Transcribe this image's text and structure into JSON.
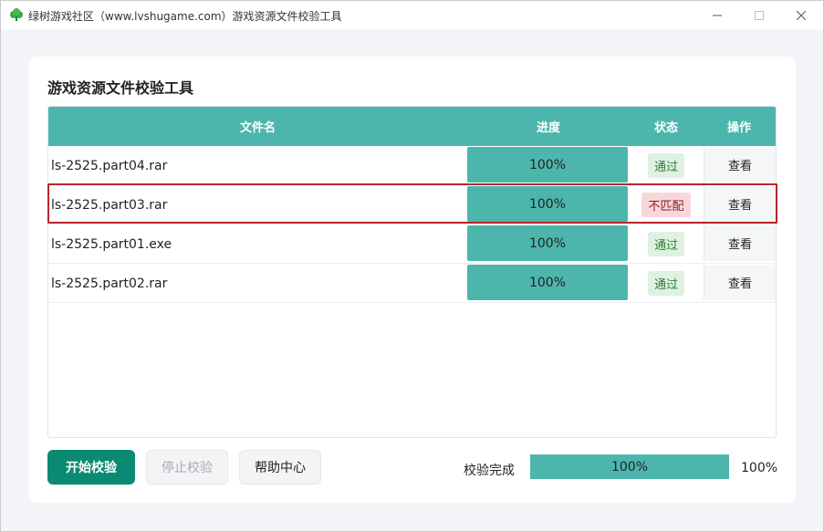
{
  "window": {
    "title": "绿树游戏社区（www.lvshugame.com）游戏资源文件校验工具",
    "controls": [
      "minimize-icon",
      "maximize-icon",
      "close-icon"
    ]
  },
  "card": {
    "title": "游戏资源文件校验工具"
  },
  "table": {
    "headers": {
      "name": "文件名",
      "progress": "进度",
      "status": "状态",
      "action": "操作"
    },
    "rows": [
      {
        "name": "ls-2525.part04.rar",
        "progress": "100%",
        "status": "通过",
        "status_type": "ok",
        "action": "查看"
      },
      {
        "name": "ls-2525.part03.rar",
        "progress": "100%",
        "status": "不匹配",
        "status_type": "bad",
        "action": "查看"
      },
      {
        "name": "ls-2525.part01.exe",
        "progress": "100%",
        "status": "通过",
        "status_type": "ok",
        "action": "查看"
      },
      {
        "name": "ls-2525.part02.rar",
        "progress": "100%",
        "status": "通过",
        "status_type": "ok",
        "action": "查看"
      }
    ]
  },
  "footer": {
    "start_button": "开始校验",
    "stop_button": "停止校验",
    "help_button": "帮助中心",
    "status_label": "校验完成",
    "overall_progress": "100%",
    "overall_percent": "100%"
  },
  "colors": {
    "accent": "#4db6ac",
    "primary_button": "#0b8a73",
    "ok_badge": "#dff1e2",
    "bad_badge": "#f8d7da",
    "highlight_border": "#b5282c"
  }
}
